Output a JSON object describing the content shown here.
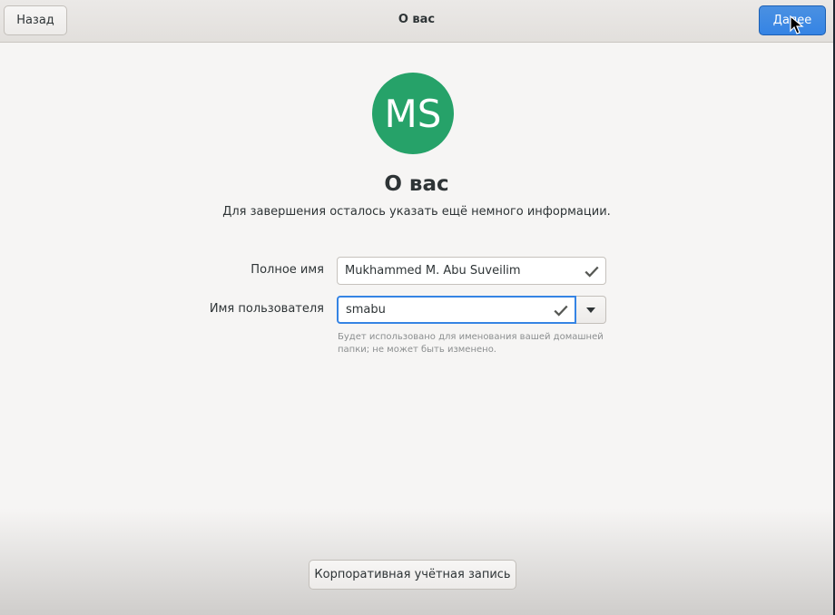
{
  "header": {
    "back_label": "Назад",
    "title": "О вас",
    "next_label": "Далее"
  },
  "avatar": {
    "initials": "MS",
    "color": "#26a269"
  },
  "main": {
    "heading": "О вас",
    "subtitle": "Для завершения осталось указать ещё немного информации."
  },
  "form": {
    "fullname": {
      "label": "Полное имя",
      "value": "Mukhammed M. Abu Suveilim",
      "status_icon": "checkmark-icon"
    },
    "username": {
      "label": "Имя пользователя",
      "value": "smabu",
      "status_icon": "checkmark-icon"
    },
    "hint": "Будет использовано для именования вашей домашней папки; не может быть изменено."
  },
  "footer": {
    "enterprise_label": "Корпоративная учётная запись"
  },
  "colors": {
    "accent": "#3584e4",
    "window_bg": "#f6f5f4"
  }
}
